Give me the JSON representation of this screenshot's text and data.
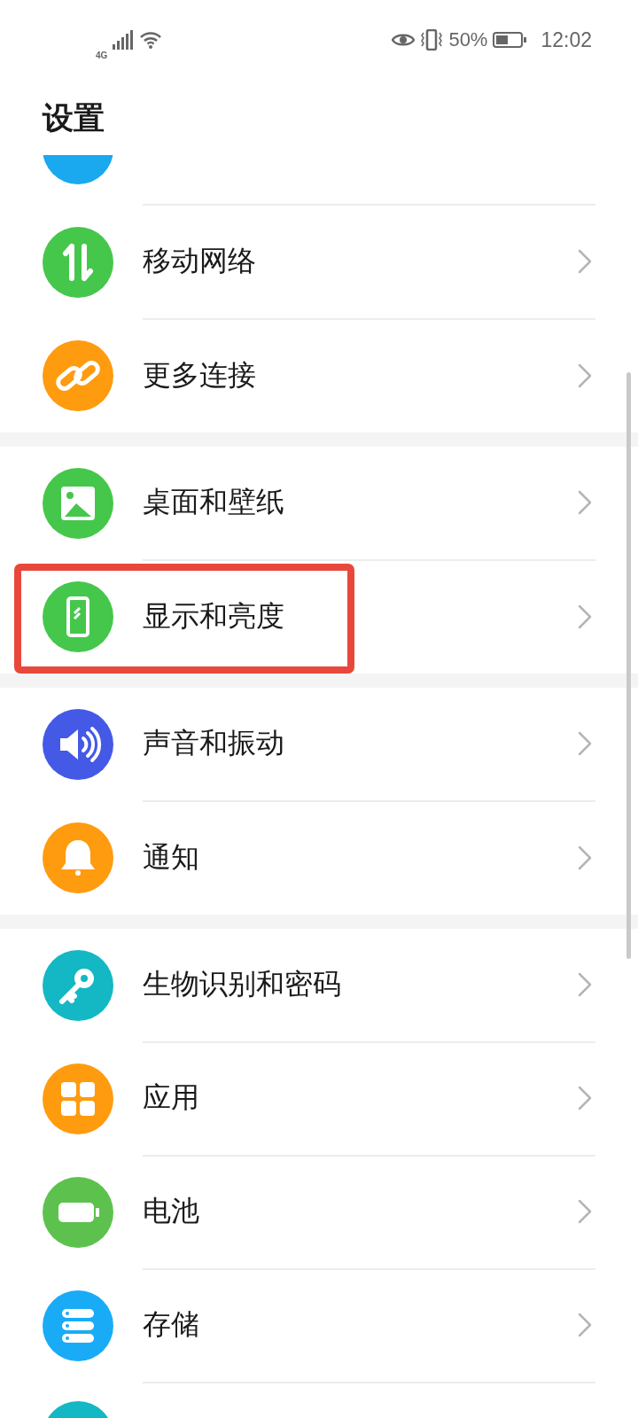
{
  "status_bar": {
    "network": "4G",
    "battery": "50%",
    "time": "12:02"
  },
  "title": "设置",
  "groups": [
    {
      "items": [
        {
          "kind": "partial_top",
          "color": "#1aa8ee"
        },
        {
          "kind": "row",
          "color": "#45c74b",
          "label": "移动网络",
          "highlighted": false
        },
        {
          "kind": "row",
          "color": "#ff9b0e",
          "label": "更多连接",
          "highlighted": false
        }
      ]
    },
    {
      "items": [
        {
          "kind": "row",
          "color": "#45c74b",
          "label": "桌面和壁纸",
          "highlighted": false
        },
        {
          "kind": "row",
          "color": "#45c74b",
          "label": "显示和亮度",
          "highlighted": true
        }
      ]
    },
    {
      "items": [
        {
          "kind": "row",
          "color": "#4459e6",
          "label": "声音和振动",
          "highlighted": false
        },
        {
          "kind": "row",
          "color": "#ff9b0e",
          "label": "通知",
          "highlighted": false
        }
      ]
    },
    {
      "items": [
        {
          "kind": "row",
          "color": "#13b8c4",
          "label": "生物识别和密码",
          "highlighted": false
        },
        {
          "kind": "row",
          "color": "#ff9b0e",
          "label": "应用",
          "highlighted": false
        },
        {
          "kind": "row",
          "color": "#5dc24d",
          "label": "电池",
          "highlighted": false
        },
        {
          "kind": "row",
          "color": "#1aabf7",
          "label": "存储",
          "highlighted": false
        },
        {
          "kind": "partial_bottom",
          "color": "#13b8c4"
        }
      ]
    }
  ]
}
